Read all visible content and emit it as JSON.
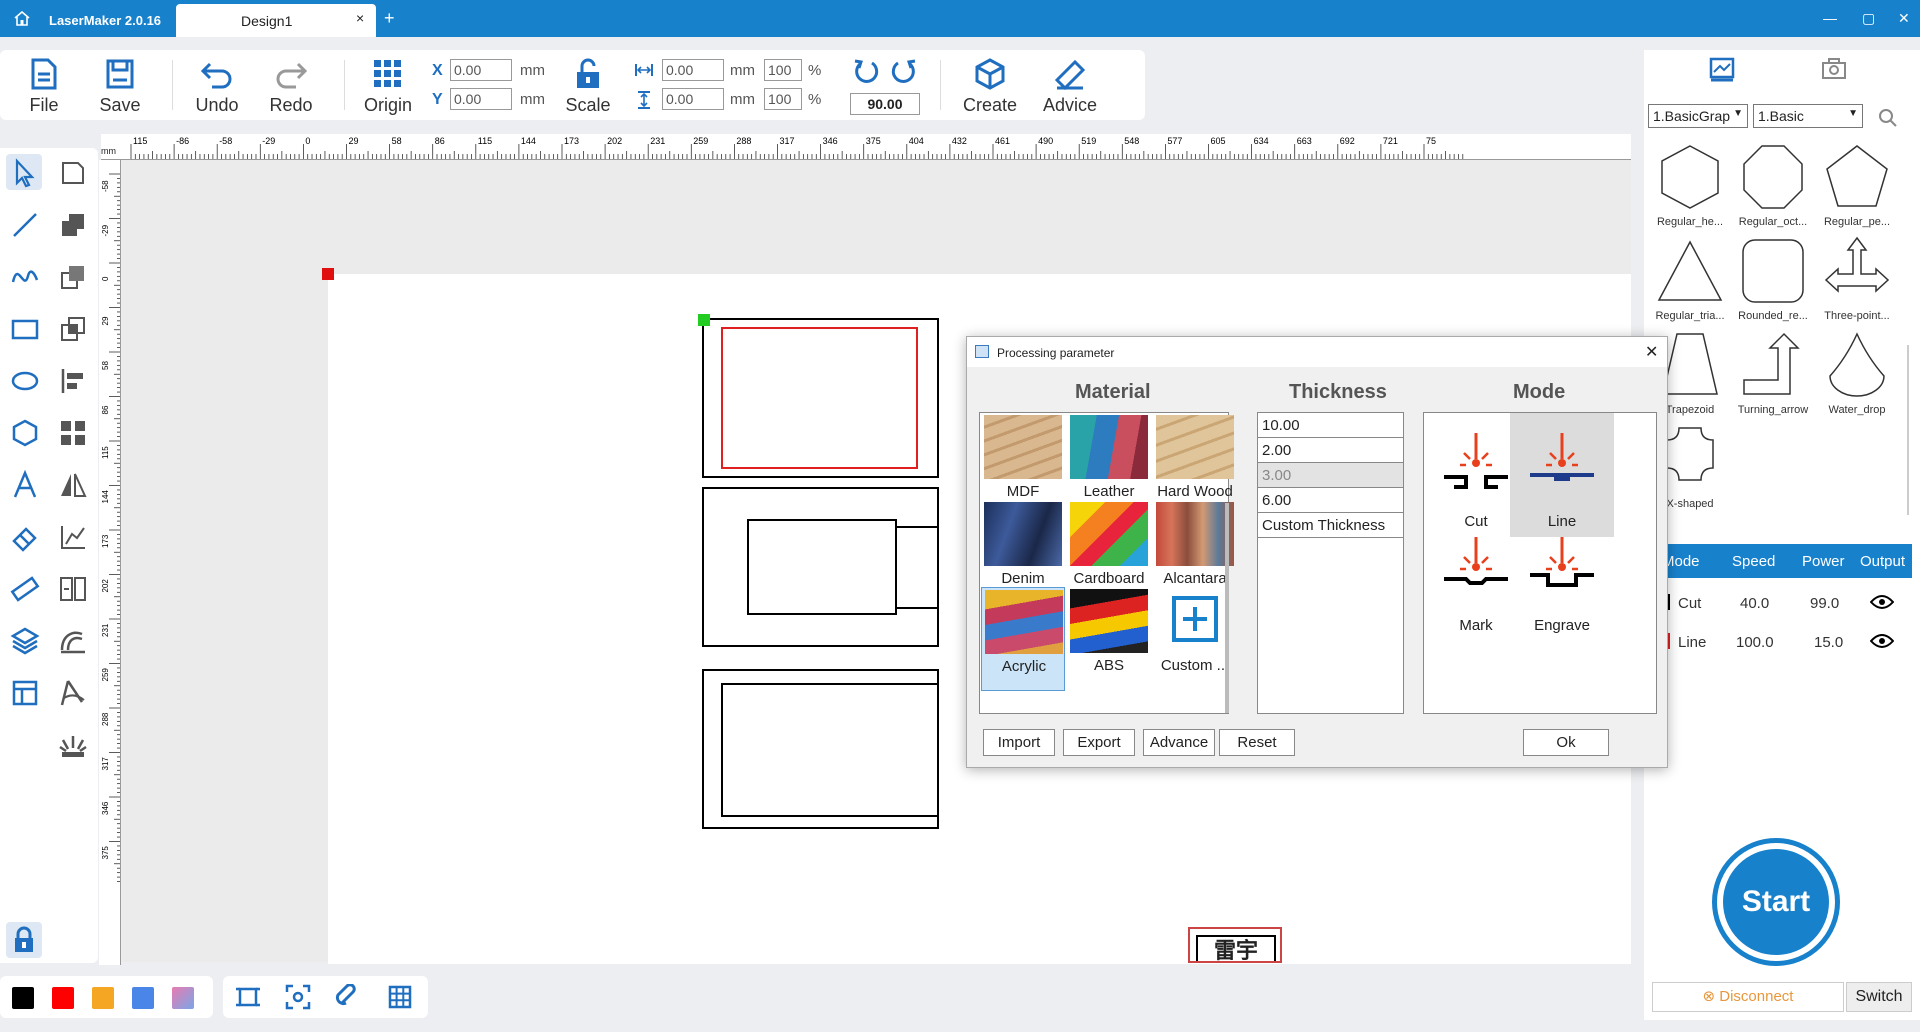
{
  "app": {
    "name": "LaserMaker 2.0.16",
    "tab": "Design1",
    "tab_close": "×",
    "new_tab": "+",
    "min": "—",
    "max": "▢",
    "close": "✕"
  },
  "toolbar": {
    "file": "File",
    "save": "Save",
    "undo": "Undo",
    "redo": "Redo",
    "origin": "Origin",
    "scale": "Scale",
    "create": "Create",
    "advice": "Advice",
    "x_label": "X",
    "y_label": "Y",
    "x_value": "0.00",
    "y_value": "0.00",
    "unit": "mm",
    "w_value": "0.00",
    "h_value": "0.00",
    "w_pct": "100",
    "h_pct": "100",
    "pct": "%",
    "rotate": "90.00"
  },
  "ruler": {
    "unit": "mm",
    "top_ticks": [
      "115",
      "-86",
      "-58",
      "-29",
      "0",
      "29",
      "58",
      "86",
      "115",
      "144",
      "173",
      "202",
      "231",
      "259",
      "288",
      "317",
      "346",
      "375",
      "404",
      "432",
      "461",
      "490",
      "519",
      "548",
      "577",
      "605",
      "634",
      "663",
      "692",
      "721",
      "75"
    ],
    "left_ticks": [
      "-58",
      "-29",
      "0",
      "29",
      "58",
      "86",
      "115",
      "144",
      "173",
      "202",
      "231",
      "259",
      "288",
      "317",
      "346",
      "375"
    ]
  },
  "library": {
    "category": "1.BasicGrap",
    "subcategory": "1.Basic",
    "shapes": [
      "Regular_he...",
      "Regular_oct...",
      "Regular_pe...",
      "Regular_tria...",
      "Rounded_re...",
      "Three-point...",
      "Trapezoid",
      "Turning_arrow",
      "Water_drop",
      "X-shaped"
    ]
  },
  "layers": {
    "headers": [
      "Mode",
      "Speed",
      "Power",
      "Output"
    ],
    "rows": [
      {
        "mode": "Cut",
        "speed": "40.0",
        "power": "99.0",
        "color": "#000000"
      },
      {
        "mode": "Line",
        "speed": "100.0",
        "power": "15.0",
        "color": "#e02020"
      }
    ]
  },
  "start": "Start",
  "disconnect": "Disconnect",
  "switch": "Switch",
  "colors": [
    "#000000",
    "#ff0000",
    "#f5a623",
    "#4a86e8",
    "#e87bb0"
  ],
  "dialog": {
    "title": "Processing parameter",
    "material_head": "Material",
    "thickness_head": "Thickness",
    "mode_head": "Mode",
    "materials": [
      "MDF",
      "Leather",
      "Hard Wood",
      "Denim",
      "Cardboard",
      "Alcantara",
      "Acrylic",
      "ABS",
      "Custom ..."
    ],
    "selected_material": "Acrylic",
    "thickness": [
      "10.00",
      "2.00",
      "3.00",
      "6.00",
      "Custom Thickness"
    ],
    "selected_thickness": "3.00",
    "modes": [
      "Cut",
      "Line",
      "Mark",
      "Engrave"
    ],
    "selected_mode": "Line",
    "buttons": {
      "import": "Import",
      "export": "Export",
      "advance": "Advance",
      "reset": "Reset",
      "ok": "Ok"
    }
  },
  "stamp": "雷宇"
}
